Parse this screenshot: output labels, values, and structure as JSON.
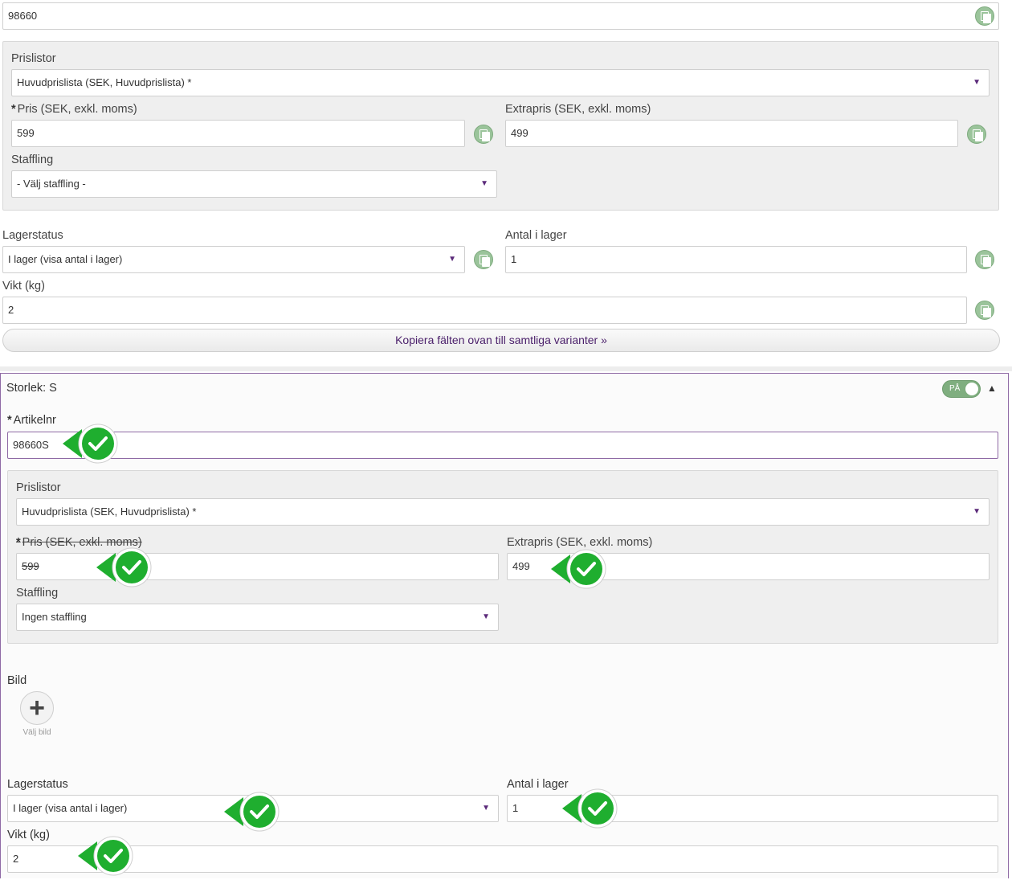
{
  "main_product": {
    "article_number": "98660",
    "pricelists_label": "Prislistor",
    "pricelist_value": "Huvudprislista (SEK, Huvudprislista) *",
    "price_label": "Pris (SEK, exkl. moms)",
    "price_value": "599",
    "extra_price_label": "Extrapris (SEK, exkl. moms)",
    "extra_price_value": "499",
    "tiering_label": "Staffling",
    "tiering_value": "- Välj staffling -",
    "stock_status_label": "Lagerstatus",
    "stock_status_value": "I lager (visa antal i lager)",
    "stock_count_label": "Antal i lager",
    "stock_count_value": "1",
    "weight_label": "Vikt (kg)",
    "weight_value": "2",
    "copy_all_label": "Kopiera fälten ovan till samtliga varianter »"
  },
  "variant": {
    "title": "Storlek: S",
    "toggle_label": "PÅ",
    "article_label": "Artikelnr",
    "article_value": "98660S",
    "pricelists_label": "Prislistor",
    "pricelist_value": "Huvudprislista (SEK, Huvudprislista) *",
    "price_label": "Pris (SEK, exkl. moms)",
    "price_value": "599",
    "extra_price_label": "Extrapris (SEK, exkl. moms)",
    "extra_price_value": "499",
    "tiering_label": "Staffling",
    "tiering_value": "Ingen staffling",
    "image_label": "Bild",
    "choose_image_label": "Välj bild",
    "stock_status_label": "Lagerstatus",
    "stock_status_value": "I lager (visa antal i lager)",
    "stock_count_label": "Antal i lager",
    "stock_count_value": "1",
    "weight_label": "Vikt (kg)",
    "weight_value": "2"
  },
  "icons": {
    "copy": "copy-icon",
    "check": "check-icon",
    "dropdown": "chevron-down-icon",
    "collapse": "chevron-up-icon",
    "add": "plus-icon"
  },
  "colors": {
    "accent": "#5b2a7a",
    "check_green": "#1fae2f",
    "copy_green": "#9bc49b"
  }
}
